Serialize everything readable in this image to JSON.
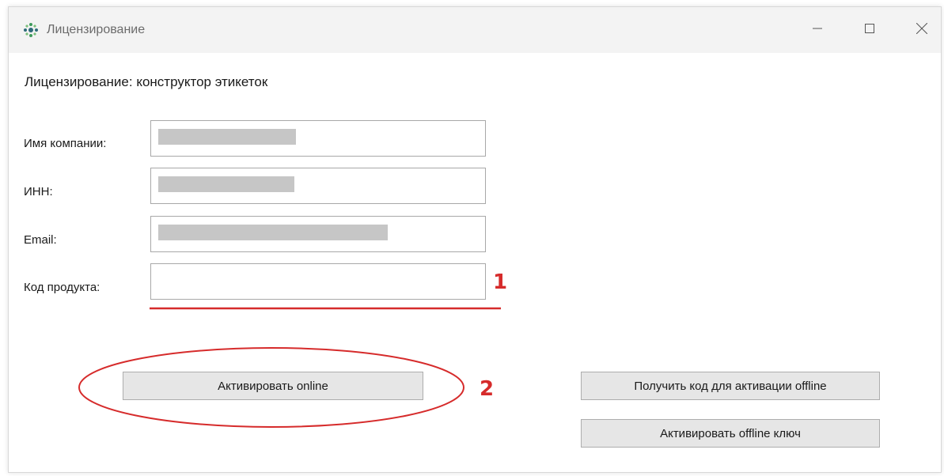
{
  "window": {
    "title": "Лицензирование",
    "controls": {
      "minimize": "minimize-icon",
      "maximize": "maximize-icon",
      "close": "close-icon"
    }
  },
  "form": {
    "heading": "Лицензирование: конструктор этикеток",
    "fields": [
      {
        "label": "Имя компании:",
        "value": ""
      },
      {
        "label": "ИНН:",
        "value": ""
      },
      {
        "label": "Email:",
        "value": ""
      },
      {
        "label": "Код продукта:",
        "value": ""
      }
    ]
  },
  "buttons": {
    "activate_online": "Активировать online",
    "get_offline_code": "Получить код для активации offline",
    "activate_offline_key": "Активировать offline ключ"
  },
  "annotations": {
    "marker_1": "1",
    "marker_2": "2",
    "color": "#d62b2b"
  }
}
